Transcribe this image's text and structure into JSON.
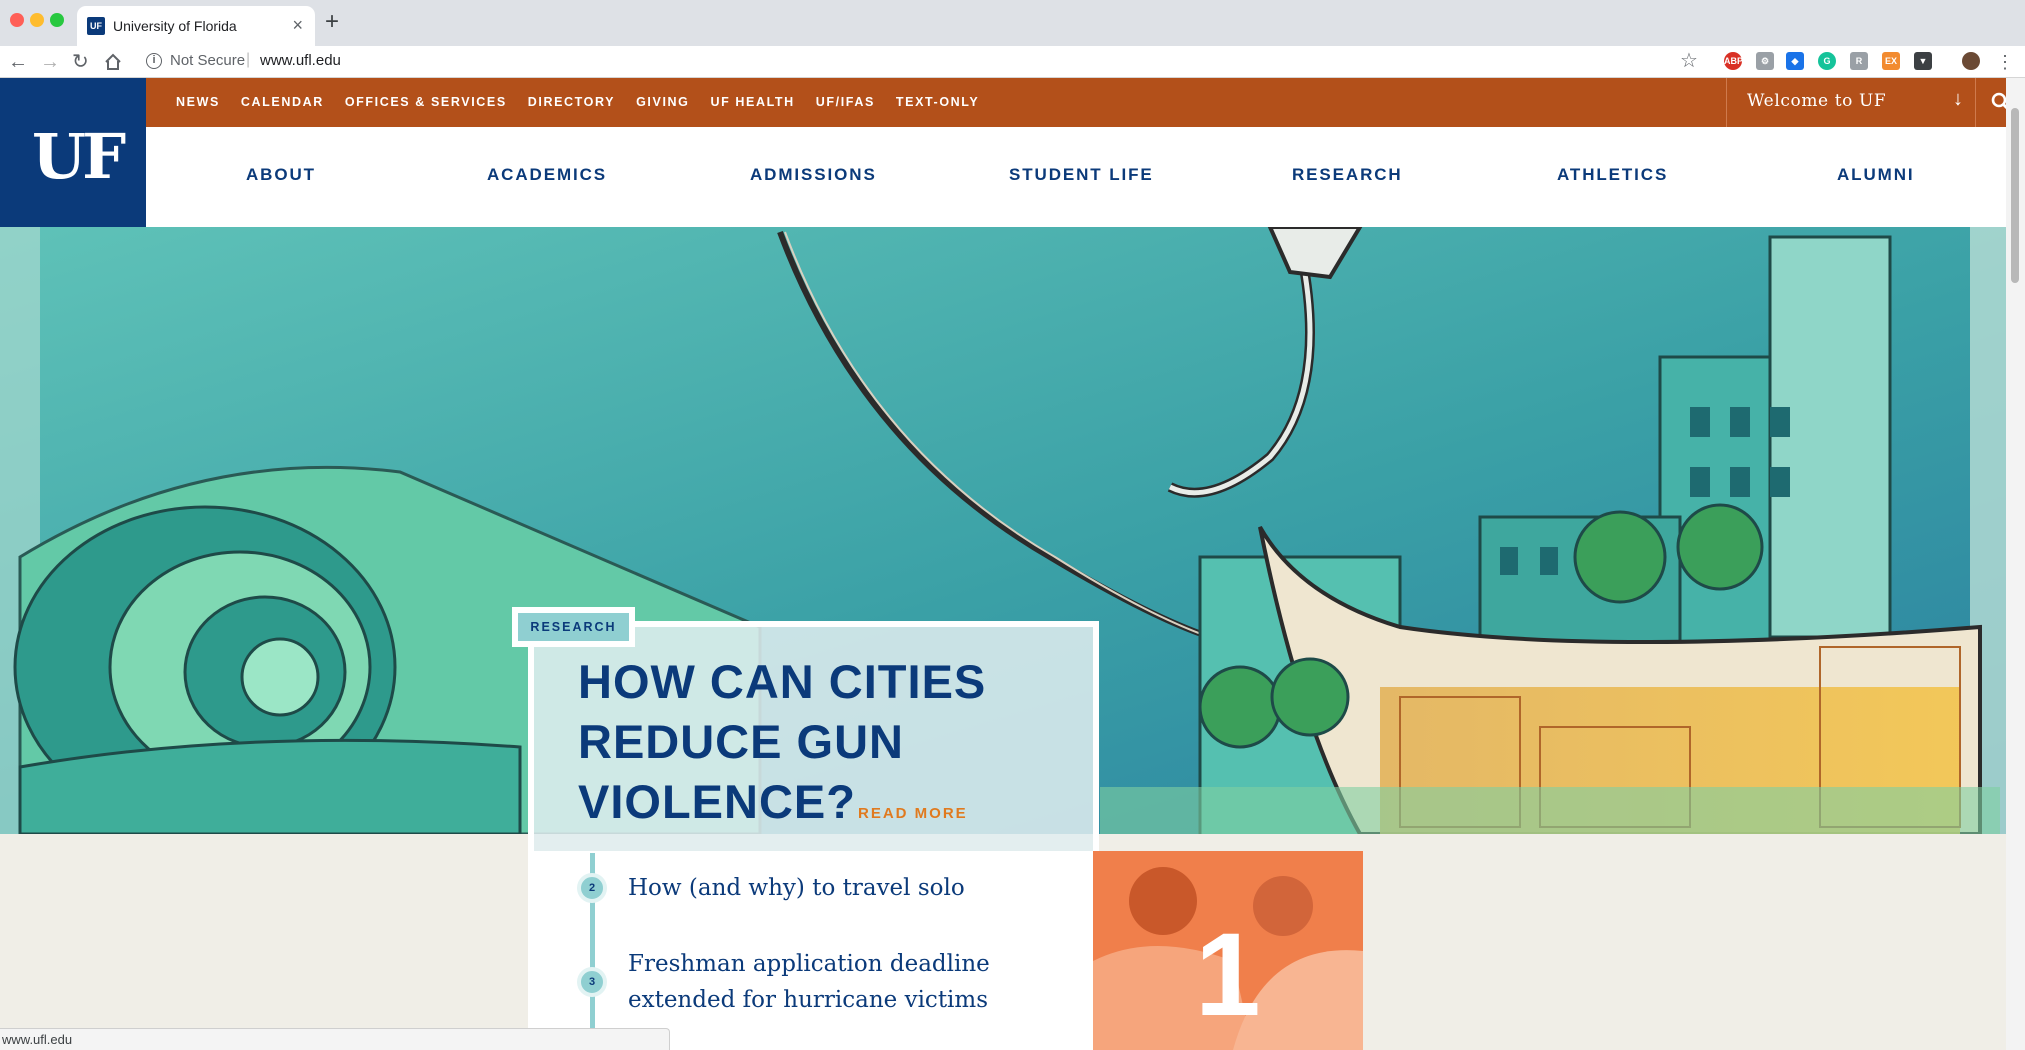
{
  "browser": {
    "tab_title": "University of Florida",
    "tab_favicon": "UF",
    "security_label": "Not Secure",
    "url": "www.ufl.edu",
    "status_url": "www.ufl.edu",
    "extensions": [
      "abp-icon",
      "extension-icon",
      "shield-icon",
      "grammarly-icon",
      "reader-icon",
      "ex-icon",
      "pocket-icon",
      "profile-avatar",
      "menu-icon"
    ]
  },
  "header": {
    "logo_text": "UF",
    "top_nav": [
      "NEWS",
      "CALENDAR",
      "OFFICES & SERVICES",
      "DIRECTORY",
      "GIVING",
      "UF HEALTH",
      "UF/IFAS",
      "TEXT-ONLY"
    ],
    "welcome_label": "Welcome to UF",
    "main_nav": [
      "ABOUT",
      "ACADEMICS",
      "ADMISSIONS",
      "STUDENT LIFE",
      "RESEARCH",
      "ATHLETICS",
      "ALUMNI"
    ]
  },
  "feature": {
    "tag": "RESEARCH",
    "headline": "HOW CAN CITIES REDUCE GUN VIOLENCE?",
    "read_more": "READ MORE",
    "stories": [
      {
        "number": "2",
        "title": "How (and why) to travel solo"
      },
      {
        "number": "3",
        "title": "Freshman application deadline extended for hurricane victims"
      }
    ],
    "photo_number": "1"
  },
  "colors": {
    "uf_blue": "#0b3a7a",
    "uf_orange_bar": "#b3501a",
    "accent_orange": "#e07a1f",
    "teal": "#8fcfd1",
    "photo_orange": "#f07f4b"
  }
}
